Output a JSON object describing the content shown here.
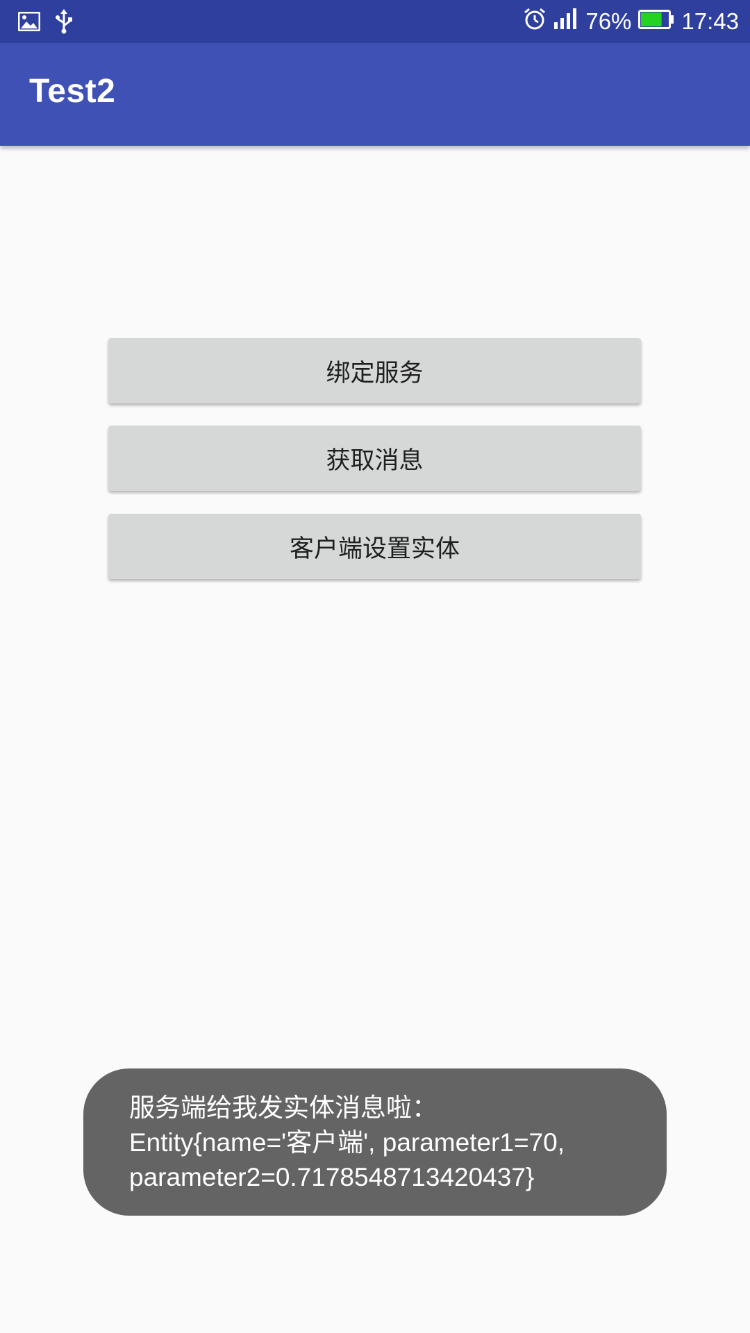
{
  "status_bar": {
    "icons_left": [
      "image-icon",
      "usb-icon"
    ],
    "icons_right": [
      "alarm-icon",
      "signal-icon"
    ],
    "battery_percent": "76%",
    "battery_level": 0.76,
    "battery_color": "#22d322",
    "time": "17:43"
  },
  "app_bar": {
    "title": "Test2",
    "color": "#3f51b5"
  },
  "buttons": [
    {
      "label": "绑定服务"
    },
    {
      "label": "获取消息"
    },
    {
      "label": "客户端设置实体"
    }
  ],
  "toast": {
    "lines": [
      "服务端给我发实体消息啦：",
      "Entity{name='客户端', parameter1=70,",
      "parameter2=0.7178548713420437}"
    ]
  }
}
